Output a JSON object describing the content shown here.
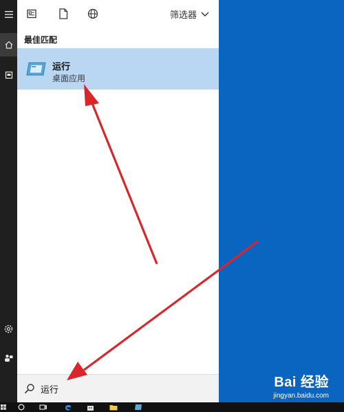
{
  "panel": {
    "filter_label": "筛选器",
    "section_label": "最佳匹配",
    "result": {
      "title": "运行",
      "subtitle": "桌面应用"
    },
    "search": {
      "value": "运行"
    }
  },
  "watermark": {
    "brand": "Bai 经验",
    "url": "jingyan.baidu.com"
  },
  "colors": {
    "desktop": "#0a65c0",
    "rail": "#1f1f1f",
    "highlight": "#b9d6f2",
    "arrow": "#d9262b"
  }
}
